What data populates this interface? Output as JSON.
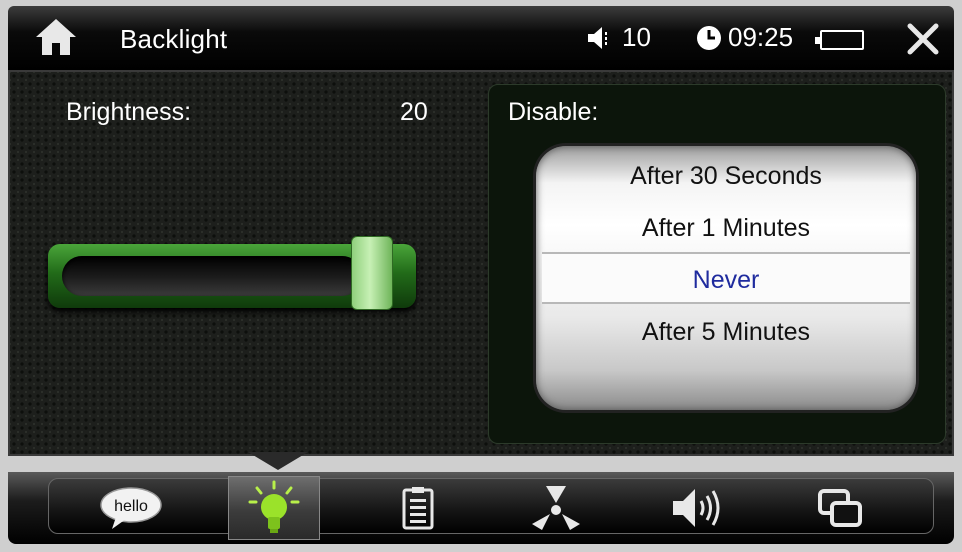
{
  "header": {
    "title": "Backlight",
    "volume": "10",
    "time": "09:25"
  },
  "icons": {
    "home": "home-icon",
    "volume": "speaker-icon",
    "clock": "clock-icon",
    "battery": "battery-icon",
    "close": "close-icon"
  },
  "brightness": {
    "label": "Brightness:",
    "value": "20",
    "level_fraction": 0.94
  },
  "disable": {
    "label": "Disable:",
    "options": [
      "After 30 Seconds",
      "After 1 Minutes",
      "Never",
      "After 5 Minutes"
    ],
    "selected": "Never"
  },
  "tabs": [
    {
      "name": "hello",
      "icon": "hello-bubble-icon",
      "active": false
    },
    {
      "name": "backlight",
      "icon": "lightbulb-icon",
      "active": true
    },
    {
      "name": "clipboard",
      "icon": "clipboard-icon",
      "active": false
    },
    {
      "name": "radiation",
      "icon": "radiation-icon",
      "active": false
    },
    {
      "name": "sound",
      "icon": "speaker-icon",
      "active": false
    },
    {
      "name": "windows",
      "icon": "windows-icon",
      "active": false
    }
  ],
  "colors": {
    "accent_green": "#4aa53a",
    "selected_text": "#1f2b9e",
    "bulb_green": "#9be22a"
  }
}
